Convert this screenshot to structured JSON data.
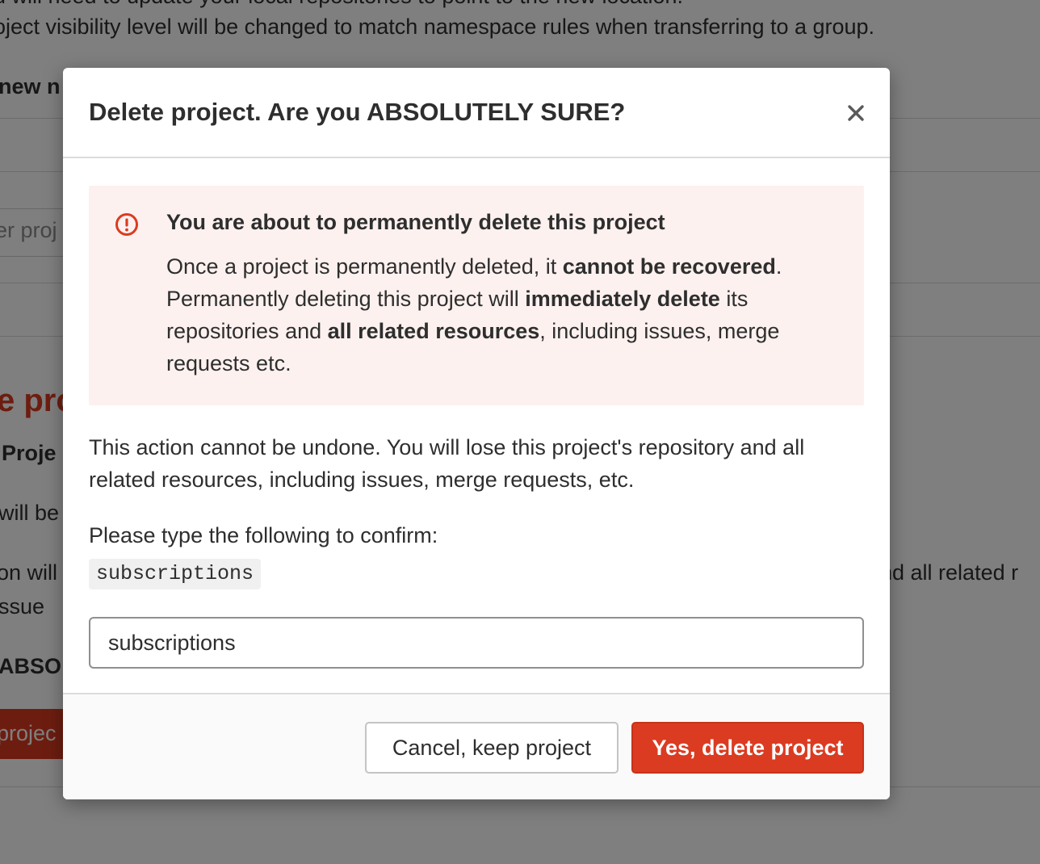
{
  "background": {
    "line_top": "u will need to update your local repositories to point to the new location.",
    "line_visibility": "oject visibility level will be changed to match namespace rules when transferring to a group.",
    "label_new": "new n",
    "select_fragment": "er proj",
    "heading_fragment": "e pro",
    "project_fragment": "Proje",
    "will_be_fragment": "will be",
    "on_will_fragment": "on will",
    "issue_fragment": "issue",
    "and_all_fragment": "nd all related r",
    "abso_fragment": "ABSO",
    "button_fragment": "projec"
  },
  "modal": {
    "title": "Delete project. Are you ABSOLUTELY SURE?",
    "close_glyph": "×",
    "alert": {
      "title": "You are about to permanently delete this project",
      "body": {
        "p1": "Once a project is permanently deleted, it ",
        "b1": "cannot be recovered",
        "p2": ". Permanently deleting this project will ",
        "b2": "immediately delete",
        "p3": " its repositories and ",
        "b3": "all related resources",
        "p4": ", including issues, merge requests etc."
      }
    },
    "description": "This action cannot be undone. You will lose this project's repository and all related resources, including issues, merge requests, etc.",
    "confirm_label": "Please type the following to confirm:",
    "confirm_code": "subscriptions",
    "confirm_input_value": "subscriptions",
    "buttons": {
      "cancel": "Cancel, keep project",
      "delete": "Yes, delete project"
    }
  },
  "colors": {
    "danger": "#db3b21",
    "alert_bg": "#fcf1ef",
    "overlay": "rgba(0,0,0,0.5)"
  },
  "icons": {
    "close": "close-icon",
    "alert": "error-icon"
  }
}
